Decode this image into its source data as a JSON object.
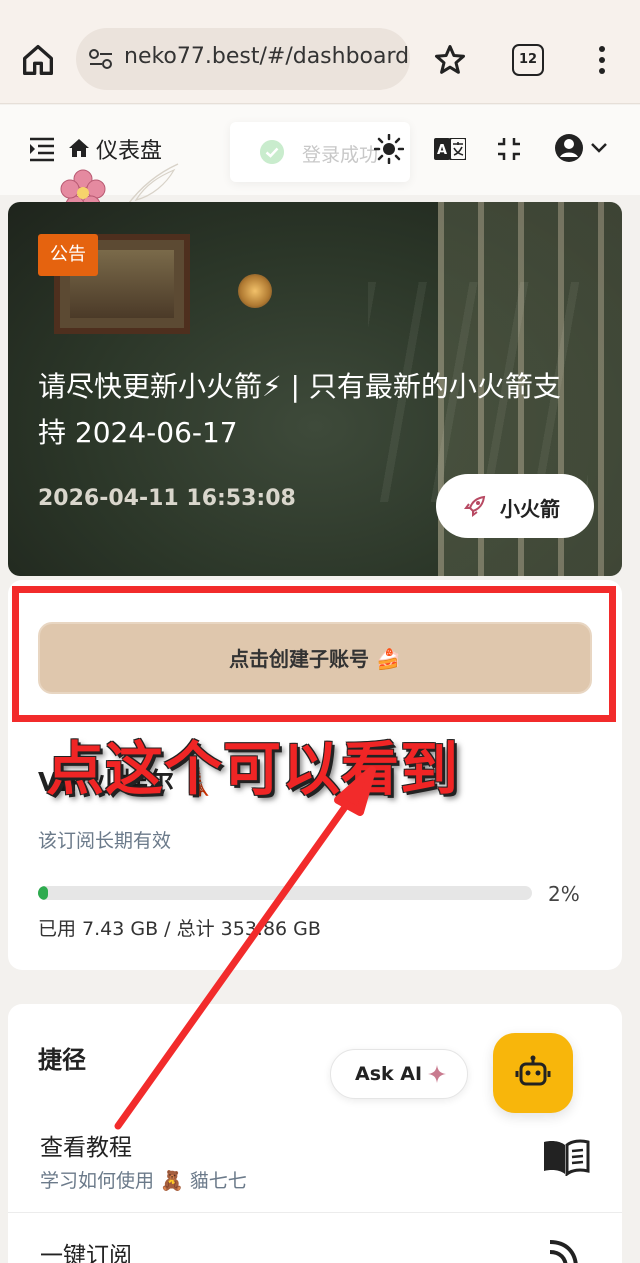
{
  "browser": {
    "url": "neko77.best/#/dashboard",
    "tab_count": "12"
  },
  "header": {
    "title": "仪表盘",
    "toast": "登录成功"
  },
  "announcement": {
    "tag": "公告",
    "title": "请尽快更新小火箭⚡ | 只有最新的小火箭支持 2024-06-17",
    "date": "2026-04-11 16:53:08",
    "button": "小火箭"
  },
  "subscription": {
    "create_button": "点击创建子账号",
    "name": "VIP 小埃尔 🗼",
    "validity": "该订阅长期有效",
    "progress_percent": 2,
    "progress_label": "2%",
    "usage": "已用 7.43 GB / 总计 353.86 GB"
  },
  "shortcuts": {
    "title": "捷径",
    "items": [
      {
        "title": "查看教程",
        "subtitle": "学习如何使用 🧸 貓七七"
      },
      {
        "title": "一键订阅"
      }
    ]
  },
  "ask_ai": {
    "label": "Ask AI"
  },
  "annotation": {
    "text": "点这个可以看到"
  },
  "colors": {
    "accent": "#e5630f",
    "create_button": "#dfc7ad",
    "progress": "#2eab4f",
    "annotation": "#f22b2b",
    "bot_button": "#f8b60b"
  }
}
